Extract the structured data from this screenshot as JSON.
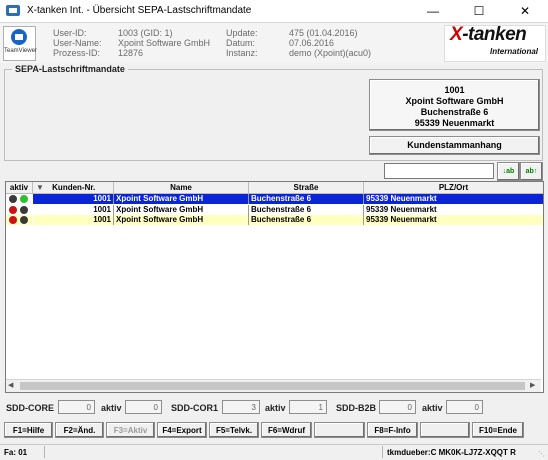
{
  "window": {
    "title": "X-tanken Int. - Übersicht SEPA-Lastschriftmandate",
    "controls": {
      "minimize": "—",
      "maximize": "☐",
      "close": "✕"
    }
  },
  "teamviewer": {
    "label": "TeamViewer",
    "icon": "teamviewer-icon"
  },
  "header": {
    "user_id_label": "User-ID:",
    "user_id": "1003 (GID: 1)",
    "user_name_label": "User-Name:",
    "user_name": "Xpoint Software GmbH",
    "process_id_label": "Prozess-ID:",
    "process_id": "12876",
    "update_label": "Update:",
    "update": "475 (01.04.2016)",
    "date_label": "Datum:",
    "date": "07.06.2016",
    "instance_label": "Instanz:",
    "instance": "demo (Xpoint)(acu0)"
  },
  "logo": {
    "x": "X",
    "rest": "-tanken",
    "sub": "International"
  },
  "group": {
    "title": "SEPA-Lastschriftmandate",
    "address": [
      "1001",
      "Xpoint Software GmbH",
      "Buchenstraße 6",
      "95339 Neuenmarkt"
    ],
    "customer_button": "Kundenstammanhang"
  },
  "search": {
    "value": "",
    "sort_up": "↓ab",
    "sort_down": "ab↑"
  },
  "table": {
    "columns": [
      "aktiv",
      "Kunden-Nr.",
      "Name",
      "Straße",
      "PLZ/Ort"
    ],
    "sort_indicator": "▼",
    "rows": [
      {
        "kundennr": "1001",
        "name": "Xpoint Software GmbH",
        "strasse": "Buchenstraße 6",
        "ort": "95339 Neuenmarkt",
        "status": [
          "#3a3a3a",
          "#2fbf2f"
        ],
        "selected": true
      },
      {
        "kundennr": "1001",
        "name": "Xpoint Software GmbH",
        "strasse": "Buchenstraße 6",
        "ort": "95339 Neuenmarkt",
        "status": [
          "#d01010",
          "#3a3a3a"
        ],
        "selected": false
      },
      {
        "kundennr": "1001",
        "name": "Xpoint Software GmbH",
        "strasse": "Buchenstraße 6",
        "ort": "95339 Neuenmarkt",
        "status": [
          "#d01010",
          "#3a3a3a"
        ],
        "selected": false
      }
    ]
  },
  "counters": {
    "core_label": "SDD-CORE",
    "core_value": "0",
    "core_aktiv_label": "aktiv",
    "core_aktiv_value": "0",
    "cor1_label": "SDD-COR1",
    "cor1_value": "3",
    "cor1_aktiv_label": "aktiv",
    "cor1_aktiv_value": "1",
    "b2b_label": "SDD-B2B",
    "b2b_value": "0",
    "b2b_aktiv_label": "aktiv",
    "b2b_aktiv_value": "0"
  },
  "fkeys": {
    "f1": "F1=Hilfe",
    "f2": "F2=Änd.",
    "f3": "F3=Aktiv",
    "f4": "F4=Export",
    "f5": "F5=Telvk.",
    "f6": "F6=Wdruf",
    "f8": "F8=F-Info",
    "f10": "F10=Ende"
  },
  "statusbar": {
    "left": "Fa: 01",
    "right": "tkmdueber:C MK0K-LJ7Z-XQQT R"
  },
  "colors": {
    "selection": "#0a24d8",
    "row_highlight": "#ffffc0",
    "logo_red": "#d40000"
  }
}
